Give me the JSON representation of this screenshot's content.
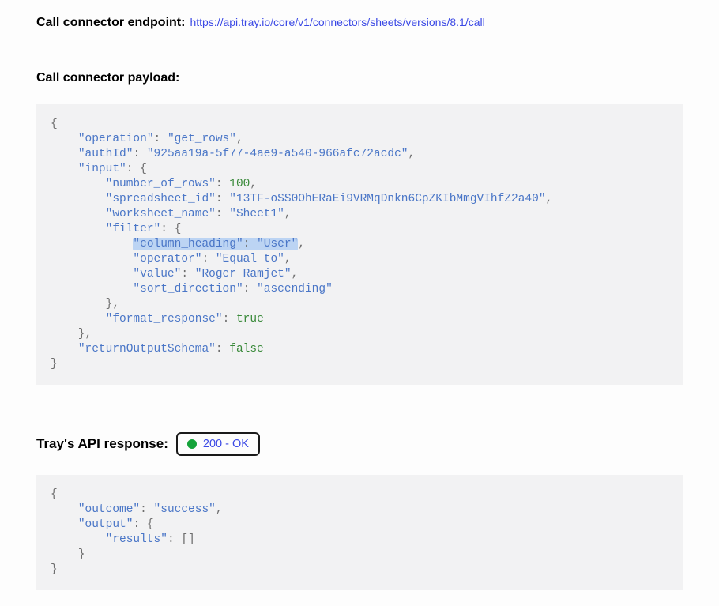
{
  "endpoint": {
    "label": "Call connector endpoint:",
    "url": "https://api.tray.io/core/v1/connectors/sheets/versions/8.1/call"
  },
  "payload": {
    "label": "Call connector payload:",
    "json": {
      "operation": "get_rows",
      "authId": "925aa19a-5f77-4ae9-a540-966afc72acdc",
      "input": {
        "number_of_rows": 100,
        "spreadsheet_id": "13TF-oSS0OhERaEi9VRMqDnkn6CpZKIbMmgVIhfZ2a40",
        "worksheet_name": "Sheet1",
        "filter": {
          "column_heading": "User",
          "operator": "Equal to",
          "value": "Roger Ramjet",
          "sort_direction": "ascending"
        },
        "format_response": true
      },
      "returnOutputSchema": false
    },
    "highlight_line": "\"column_heading\": \"User\""
  },
  "response": {
    "label": "Tray's API response:",
    "status_code": "200 - OK",
    "status_color": "#15a33a",
    "json": {
      "outcome": "success",
      "output": {
        "results": []
      }
    }
  }
}
